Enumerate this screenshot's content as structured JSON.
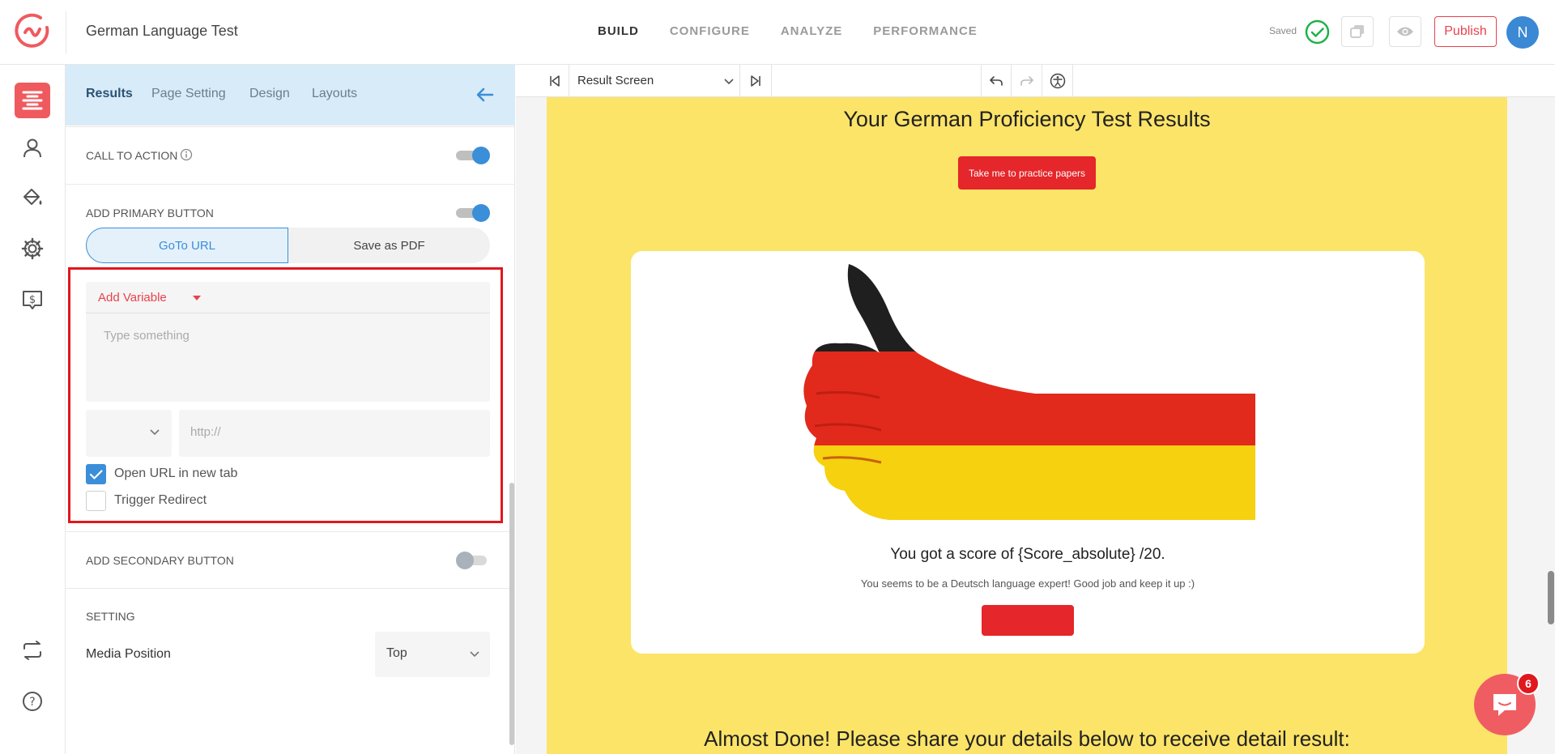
{
  "header": {
    "quiz_title": "German Language Test",
    "nav": [
      "BUILD",
      "CONFIGURE",
      "ANALYZE",
      "PERFORMANCE"
    ],
    "active_nav": "BUILD",
    "saved_label": "Saved",
    "publish_label": "Publish",
    "avatar_initial": "N"
  },
  "rail": {
    "icons": [
      "builder-icon",
      "user-icon",
      "paint-bucket-icon",
      "gear-icon",
      "pricing-icon",
      "sync-icon",
      "help-icon"
    ],
    "active": "builder-icon"
  },
  "panel": {
    "tabs": [
      "Results",
      "Page Setting",
      "Design",
      "Layouts"
    ],
    "active_tab": "Results",
    "call_to_action_label": "CALL TO ACTION",
    "call_to_action_on": true,
    "primary_button_label": "ADD PRIMARY BUTTON",
    "primary_button_on": true,
    "segment_options": [
      "GoTo URL",
      "Save as PDF"
    ],
    "segment_selected": "GoTo URL",
    "add_variable_label": "Add Variable",
    "editor_placeholder": "Type something",
    "url_placeholder": "http://",
    "open_new_tab_label": "Open URL in new tab",
    "open_new_tab_checked": true,
    "trigger_redirect_label": "Trigger Redirect",
    "trigger_redirect_checked": false,
    "secondary_button_label": "ADD SECONDARY BUTTON",
    "secondary_button_on": false,
    "setting_label": "SETTING",
    "media_position_label": "Media Position",
    "media_position_value": "Top"
  },
  "preview": {
    "screen_select": "Result Screen",
    "result_title": "Your German Proficiency Test Results",
    "cta_label": "Take me to practice papers",
    "score_text": "You got a score of {Score_absolute} /20.",
    "description": "You seems to be a Deutsch language expert! Good job and keep it up :)",
    "almost_done": "Almost Done! Please share your details below to receive detail result:"
  },
  "chat": {
    "badge_count": "6"
  },
  "colors": {
    "accent_red": "#e8424d",
    "accent_blue": "#3b8ed8",
    "canvas_yellow": "#fce468",
    "highlight_box": "#e0171e"
  }
}
